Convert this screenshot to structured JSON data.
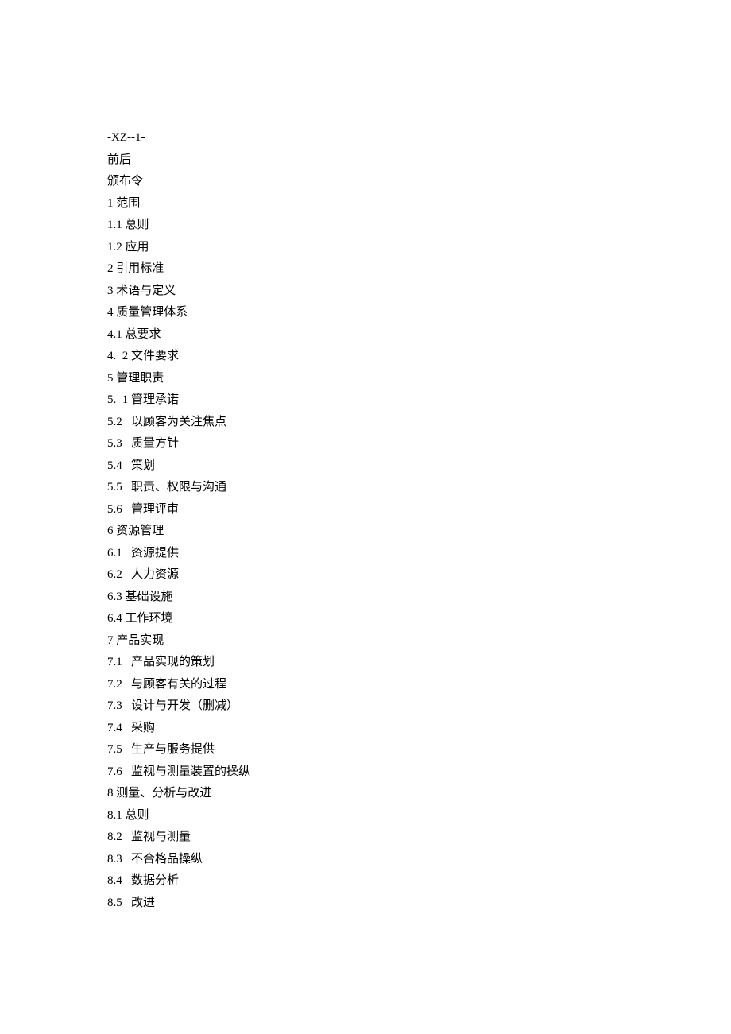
{
  "header": {
    "code": "-XZ--1-",
    "line1": "前后",
    "line2": "颁布令"
  },
  "toc": [
    "1 范围",
    "1.1 总则",
    "1.2 应用",
    "2 引用标准",
    "3 术语与定义",
    "4 质量管理体系",
    "4.1 总要求",
    "4.  2 文件要求",
    "5 管理职责",
    "5.  1 管理承诺",
    "5.2   以顾客为关注焦点",
    "5.3   质量方针",
    "5.4   策划",
    "5.5   职责、权限与沟通",
    "5.6   管理评审",
    "6 资源管理",
    "6.1   资源提供",
    "6.2   人力资源",
    "6.3 基础设施",
    "6.4 工作环境",
    "7 产品实现",
    "7.1   产品实现的策划",
    "7.2   与顾客有关的过程",
    "7.3   设计与开发（删减）",
    "7.4   采购",
    "7.5   生产与服务提供",
    "7.6   监视与测量装置的操纵",
    "8 测量、分析与改进",
    "8.1 总则",
    "8.2   监视与测量",
    "8.3   不合格品操纵",
    "8.4   数据分析",
    "8.5   改进"
  ]
}
